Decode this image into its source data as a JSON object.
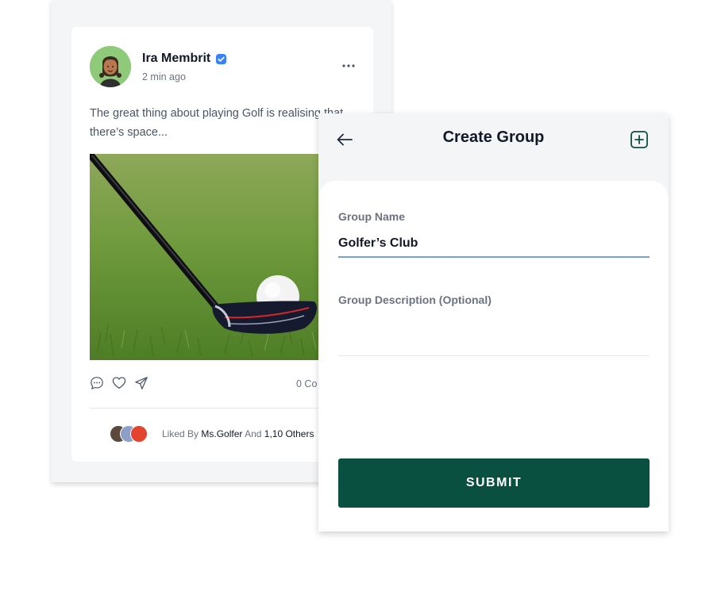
{
  "post": {
    "author": "Ira Membrit",
    "time": "2 min ago",
    "text": "The great thing about playing Golf is realising that there’s space...",
    "comment_count": "0 Co",
    "liked": {
      "prefix": "Liked By",
      "user": "Ms.Golfer",
      "joiner": "And",
      "others": "1,10 Others"
    },
    "icons": {
      "verified": "verified-badge-icon",
      "more": "more-horizontal-icon",
      "comment": "comment-icon",
      "like": "heart-icon",
      "share": "send-icon"
    },
    "colors": {
      "verified": "#3b82f6",
      "avatar_bg": "#8fc97a"
    }
  },
  "create_group": {
    "title": "Create Group",
    "back_icon": "arrow-left-icon",
    "add_icon": "plus-square-icon",
    "group_name_label": "Group Name",
    "group_name_value": "Golfer’s Club",
    "description_label": "Group Description (Optional)",
    "description_value": "",
    "submit_label": "SUBMIT",
    "colors": {
      "accent": "#0a5040",
      "input_underline": "#7b9fd4"
    }
  }
}
